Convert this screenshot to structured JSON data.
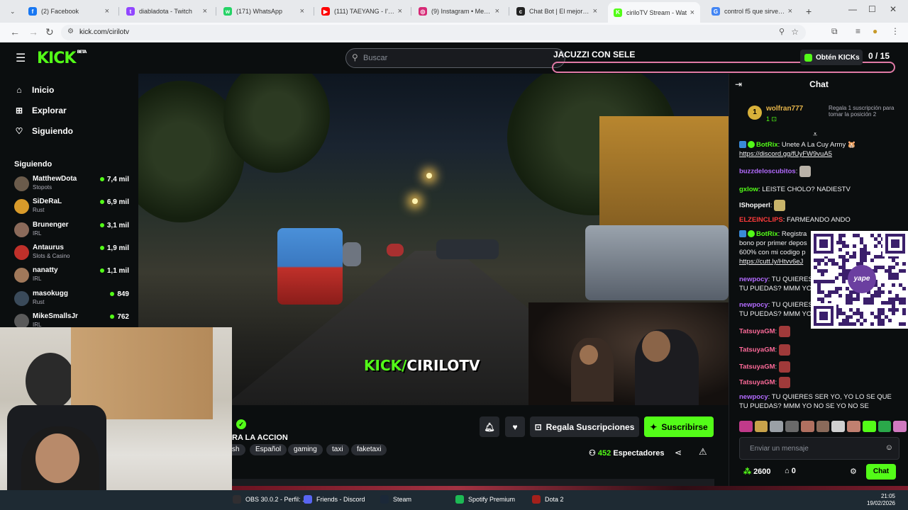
{
  "browser": {
    "tabs": [
      {
        "title": "(2) Facebook",
        "color": "#1877f2",
        "glyph": "f"
      },
      {
        "title": "diabladota - Twitch",
        "color": "#9146ff",
        "glyph": "t"
      },
      {
        "title": "(171) WhatsApp",
        "color": "#25d366",
        "glyph": "w"
      },
      {
        "title": "(111) TAEYANG - I'LL BE T",
        "color": "#ff0000",
        "glyph": "▶"
      },
      {
        "title": "(9) Instagram • Mensajes",
        "color": "#d62976",
        "glyph": "◎"
      },
      {
        "title": "Chat Bot | El mejor softw",
        "color": "#222222",
        "glyph": "c"
      },
      {
        "title": "ciriloTV Stream - Wat",
        "color": "#53fc18",
        "glyph": "K"
      },
      {
        "title": "control f5 que sirve - Bus",
        "color": "#4285f4",
        "glyph": "G"
      }
    ],
    "url": "kick.com/cirilotv"
  },
  "kick": {
    "logo": "KICK",
    "beta": "BETA",
    "search_placeholder": "Buscar",
    "banner": "JACUZZI CON SELE",
    "get_kicks": "Obtén KICKs",
    "kick_count": "0 / 15"
  },
  "sidebar": {
    "nav": [
      {
        "label": "Inicio",
        "icon": "home-icon"
      },
      {
        "label": "Explorar",
        "icon": "compass-icon"
      },
      {
        "label": "Siguiendo",
        "icon": "heart-icon"
      }
    ],
    "following_title": "Siguiendo",
    "following": [
      {
        "name": "MatthewDota",
        "category": "Stopots",
        "viewers": "7,4 mil",
        "color": "#6b5b4b"
      },
      {
        "name": "SiDeRaL",
        "category": "Rust",
        "viewers": "6,9 mil",
        "color": "#d89a2a"
      },
      {
        "name": "Brunenger",
        "category": "IRL",
        "viewers": "3,1 mil",
        "color": "#8b6a5a"
      },
      {
        "name": "Antaurus",
        "category": "Slots & Casino",
        "viewers": "1,9 mil",
        "color": "#c0302a"
      },
      {
        "name": "nanatty",
        "category": "IRL",
        "viewers": "1,1 mil",
        "color": "#a0785a"
      },
      {
        "name": "masokugg",
        "category": "Rust",
        "viewers": "849",
        "color": "#3a4a5a"
      },
      {
        "name": "MikeSmallsJr",
        "category": "IRL",
        "viewers": "762",
        "color": "#5a5a5a"
      }
    ]
  },
  "player": {
    "overlay_kick": "KICK/",
    "overlay_name": "CIRILOTV"
  },
  "stream": {
    "title": "RA LA ACCION",
    "tags": [
      "sh",
      "Español",
      "gaming",
      "taxi",
      "faketaxi"
    ],
    "gift_subs": "Regala Suscripciones",
    "subscribe": "Suscribirse",
    "viewers_count": "452",
    "viewers_label": "Espectadores"
  },
  "chat": {
    "title": "Chat",
    "gift_rank": "1",
    "gift_user": "wolfran777",
    "gift_count": "1",
    "gift_note": "Regala 1 suscripción para tomar la posición 2",
    "messages": [
      {
        "user": "BotRix",
        "color": "#53fc18",
        "text": "Unete A La Cuy Army 🐹",
        "link": "https://discord.gg/fUyFW9vuA5"
      },
      {
        "user": "buzzdeloscubitos",
        "color": "#b36bff",
        "text": ""
      },
      {
        "user": "gxlow",
        "color": "#53fc18",
        "text": "LEISTE CHOLO? NADIESTV"
      },
      {
        "user": "lShopperl",
        "color": "#ffffff",
        "text": ""
      },
      {
        "user": "ELZEINCLIPS",
        "color": "#ff3b3b",
        "text": "FARMEANDO ANDO"
      },
      {
        "user": "BotRix",
        "color": "#53fc18",
        "text": "Registra",
        "line2": "bono por primer depos",
        "line3": "600% con mi codigo p",
        "link": "https://cutt.ly/Htvv6eJ"
      },
      {
        "user": "newpocy",
        "color": "#b36bff",
        "text": "TU QUIERES",
        "line2": "TU PUEDAS? MMM YO"
      },
      {
        "user": "newpocy",
        "color": "#b36bff",
        "text": "TU QUIERES",
        "line2": "TU PUEDAS? MMM YO"
      },
      {
        "user": "TatsuyaGM",
        "color": "#ff6b9a",
        "text": ""
      },
      {
        "user": "TatsuyaGM",
        "color": "#ff6b9a",
        "text": ""
      },
      {
        "user": "TatsuyaGM",
        "color": "#ff6b9a",
        "text": ""
      },
      {
        "user": "TatsuyaGM",
        "color": "#ff6b9a",
        "text": ""
      },
      {
        "user": "newpocy",
        "color": "#b36bff",
        "text": "TU QUIERES SER YO, YO LO SE QUE",
        "line2": "TU PUEDAS? MMM YO NO SE YO NO SE"
      }
    ],
    "input_placeholder": "Enviar un mensaje",
    "points": "2600",
    "store_count": "0",
    "send": "Chat"
  },
  "qr": {
    "brand": "yape"
  },
  "taskbar": {
    "items": [
      {
        "label": "OBS 30.0.2 - Perfil: ...",
        "color": "#302e31"
      },
      {
        "label": "Friends - Discord",
        "color": "#5865f2"
      },
      {
        "label": "Steam",
        "color": "#1b2838"
      },
      {
        "label": "Spotify Premium",
        "color": "#1db954"
      },
      {
        "label": "Dota 2",
        "color": "#a4201b"
      }
    ],
    "time": "21:05",
    "date": "19/02/2026"
  }
}
